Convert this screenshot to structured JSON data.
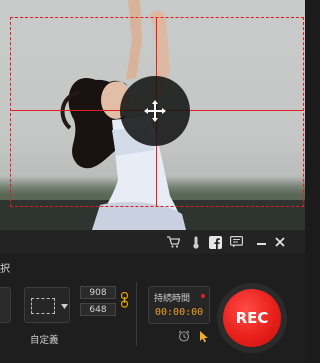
{
  "panel": {
    "menu_text": "択",
    "width_value": "908",
    "height_value": "648",
    "custom_label": "自定義",
    "duration_label": "持続時間",
    "duration_value": "00:00:00",
    "rec_label": "REC"
  },
  "icons": {
    "cart": "cart-icon",
    "thermometer": "thermometer-icon",
    "facebook": "facebook-icon",
    "message": "message-icon",
    "minimize": "minimize-icon",
    "close": "close-icon",
    "move": "move-icon",
    "lock": "lock-icon",
    "alarm": "alarm-clock-icon",
    "cursor": "cursor-icon"
  },
  "colors": {
    "accent_red": "#e8201c",
    "guide_red": "#e02020",
    "lock_orange": "#e6a400",
    "duration_orange": "#f0a020"
  }
}
